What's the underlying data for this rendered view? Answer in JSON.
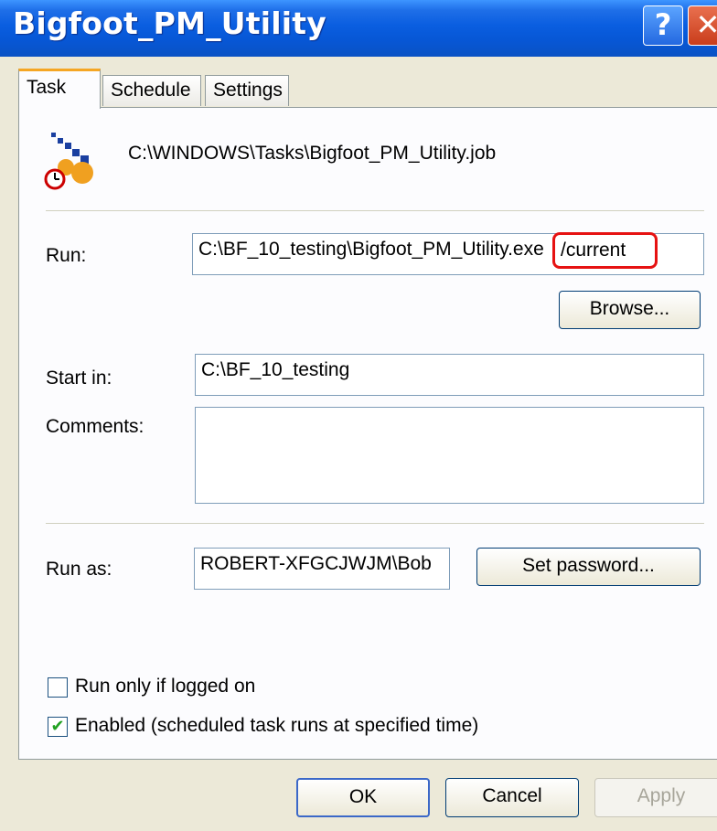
{
  "window": {
    "title": "Bigfoot_PM_Utility",
    "help_glyph": "?",
    "close_glyph": "✕"
  },
  "tabs": [
    {
      "label": "Task",
      "active": true
    },
    {
      "label": "Schedule",
      "active": false
    },
    {
      "label": "Settings",
      "active": false
    }
  ],
  "task": {
    "job_path": "C:\\WINDOWS\\Tasks\\Bigfoot_PM_Utility.job",
    "run_label": "Run:",
    "run_value": "C:\\BF_10_testing\\Bigfoot_PM_Utility.exe",
    "run_highlight": "/current",
    "browse_label": "Browse...",
    "start_in_label": "Start in:",
    "start_in_value": "C:\\BF_10_testing",
    "comments_label": "Comments:",
    "comments_value": "",
    "run_as_label": "Run as:",
    "run_as_value": "ROBERT-XFGCJWJM\\Bob",
    "set_password_label": "Set password...",
    "run_only_logged_on": {
      "label": "Run only if logged on",
      "checked": false
    },
    "enabled": {
      "label": "Enabled (scheduled task runs at specified time)",
      "checked": true
    }
  },
  "buttons": {
    "ok": "OK",
    "cancel": "Cancel",
    "apply": "Apply"
  },
  "colors": {
    "titlebar": "#0a5ee0",
    "highlight_outline": "#e61212",
    "check": "#21a121"
  },
  "icons": {
    "job": "scheduled-task-icon",
    "help": "help-icon",
    "close": "close-icon"
  }
}
